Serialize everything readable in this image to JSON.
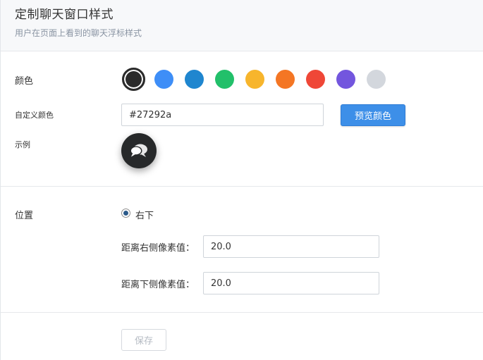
{
  "header": {
    "title": "定制聊天窗口样式",
    "subtitle": "用户在页面上看到的聊天浮标样式"
  },
  "color_section": {
    "label": "颜色",
    "swatches": [
      {
        "color": "#2b2b2b",
        "selected": true
      },
      {
        "color": "#3e8ef7",
        "selected": false
      },
      {
        "color": "#1f86cf",
        "selected": false
      },
      {
        "color": "#22c06a",
        "selected": false
      },
      {
        "color": "#f7b52c",
        "selected": false
      },
      {
        "color": "#f47624",
        "selected": false
      },
      {
        "color": "#ef4737",
        "selected": false
      },
      {
        "color": "#7356de",
        "selected": false
      },
      {
        "color": "#d3d7dd",
        "selected": false
      }
    ],
    "custom_label": "自定义颜色",
    "custom_value": "#27292a",
    "preview_button": "预览颜色",
    "example_label": "示例",
    "example_icon": "chat-bubbles-icon"
  },
  "position_section": {
    "label": "位置",
    "option_label": "右下",
    "option_selected": true,
    "right_label": "距离右侧像素值：",
    "right_value": "20.0",
    "bottom_label": "距离下侧像素值：",
    "bottom_value": "20.0"
  },
  "actions": {
    "save_label": "保存"
  }
}
